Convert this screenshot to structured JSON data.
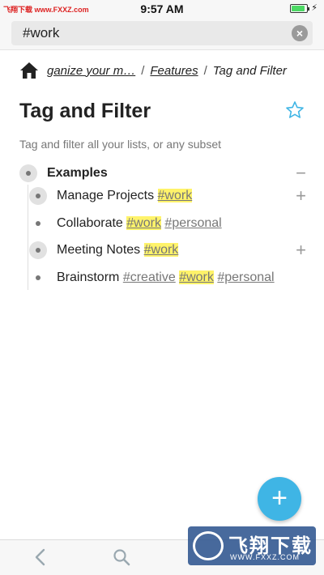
{
  "status_bar": {
    "carrier": "飞翔下载 www.FXXZ.com",
    "time": "9:57 AM",
    "battery_level": 0.9
  },
  "search": {
    "value": "#work"
  },
  "breadcrumb": {
    "items": [
      "ganize your m…",
      "Features",
      "Tag and Filter"
    ],
    "separator": "/"
  },
  "page": {
    "title": "Tag and Filter",
    "description": "Tag and filter all your lists, or any subset"
  },
  "outline": {
    "parent": "Examples",
    "items": [
      {
        "text": "Manage Projects",
        "tags": [
          "#work"
        ],
        "has_children": true
      },
      {
        "text": "Collaborate",
        "tags": [
          "#work",
          "#personal"
        ],
        "has_children": false
      },
      {
        "text": "Meeting Notes",
        "tags": [
          "#work"
        ],
        "has_children": true
      },
      {
        "text": "Brainstorm",
        "tags": [
          "#creative",
          "#work",
          "#personal"
        ],
        "has_children": false
      }
    ]
  },
  "actions": {
    "collapse": "−",
    "expand": "+",
    "fab": "+"
  },
  "watermark": {
    "main": "飞翔下载",
    "sub": "WWW.FXXZ.COM"
  },
  "colors": {
    "accent": "#3fb5e5",
    "highlight": "#fff36a"
  }
}
